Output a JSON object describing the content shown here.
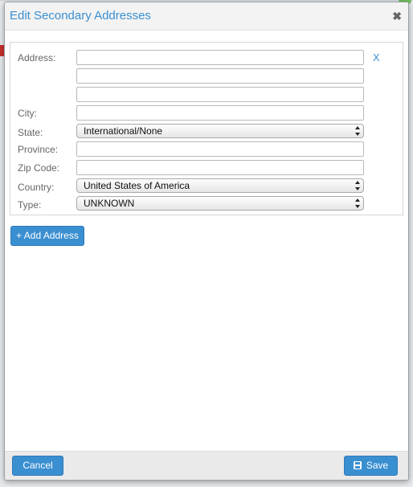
{
  "dialog": {
    "title": "Edit Secondary Addresses",
    "close_icon": "close-icon",
    "close_glyph": "✖"
  },
  "address": {
    "labels": {
      "address": "Address:",
      "city": "City:",
      "state": "State:",
      "province": "Province:",
      "zip": "Zip Code:",
      "country": "Country:",
      "type": "Type:"
    },
    "values": {
      "line1": "",
      "line2": "",
      "line3": "",
      "city": "",
      "province": "",
      "zip": ""
    },
    "selects": {
      "state": "International/None",
      "country": "United States of America",
      "type": "UNKNOWN"
    },
    "remove_label": "X"
  },
  "actions": {
    "add_address": "+ Add Address",
    "cancel": "Cancel",
    "save": "Save",
    "save_icon": "save-icon"
  },
  "colors": {
    "accent": "#3a8fd1",
    "footer": "#eaeaea",
    "header": "#f3f3f3"
  }
}
